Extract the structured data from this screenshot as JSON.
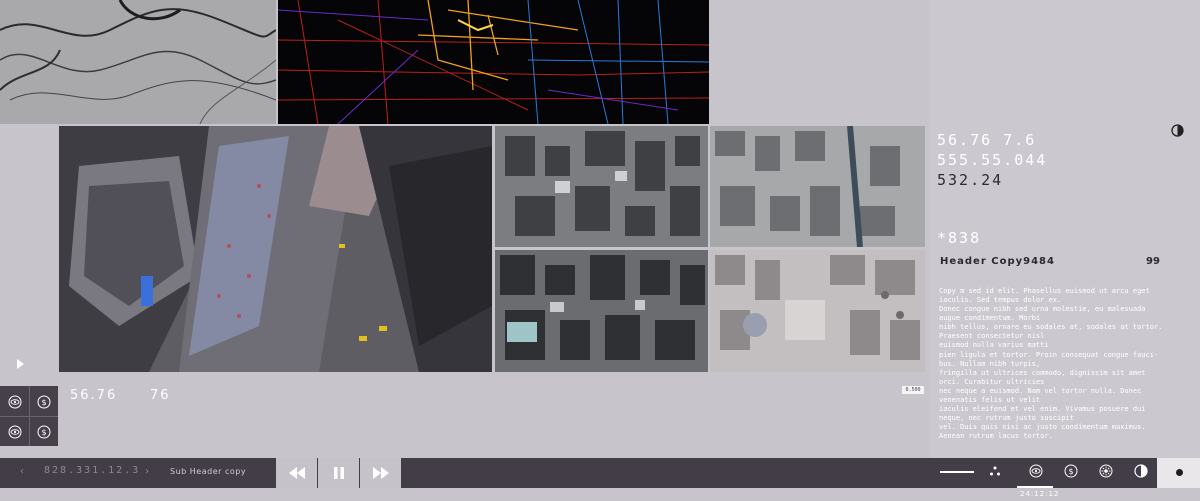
{
  "panels": {
    "readouts": {
      "line1": "56.76    7.6",
      "line2": "555.55.044",
      "line3": "532.24",
      "line4": "*838"
    },
    "header": {
      "title": "Header Copy9484",
      "count": "99"
    },
    "body_text": {
      "para1": "Copy m sed id elit. Phasellus euismod ut arcu eget\niaculis. Sed tempus dolor ex.\nDonec congue nibh sed urna molestie, eu malesuada\naugue condimentum. Morbi\nnibh tellus, ornare eu sodales at, sodales at tortor.\nPraesent consectetur nisl\neuismod nulla varius matti",
      "para2": "pien ligula et tortor. Proin consequat congue fauci-\nbus. Nullam nibh turpis,\n fringilla ut ultrices commodo, dignissim sit amet\norci. Curabitur ultricies\nnec neque a euismod. Nam vel tortor nulla. Donec\nvenenatis felis ut velit\niaculis eleifend et vel enim. Vivamus posuere dui\nneque, nec rutrum justo suscipit\n vel. Duis quis nisi ac justo condimentum maximus.\nAenean rutrum lacus tortor."
    }
  },
  "mid": {
    "value_a": "56.76",
    "value_b": "76"
  },
  "scale_chip": "0.500",
  "bottom_bar": {
    "prev_arrow": "‹",
    "coords": "828.331.12.3",
    "next_arrow": "›",
    "sub_header": "Sub Header copy",
    "time": "24:12:12"
  },
  "icons": {
    "mini": [
      "eye-icon",
      "dollar-icon",
      "eye-icon",
      "dollar-icon"
    ],
    "transport": [
      "rewind-icon",
      "pause-icon",
      "fast-forward-icon"
    ],
    "toolbar": [
      "dash-icon",
      "dots-icon",
      "eye-icon",
      "dollar-icon",
      "sun-icon",
      "contrast-icon"
    ]
  },
  "colors": {
    "background": "#c7c5cb",
    "bar": "#433d47",
    "accent": "#ffffff"
  }
}
